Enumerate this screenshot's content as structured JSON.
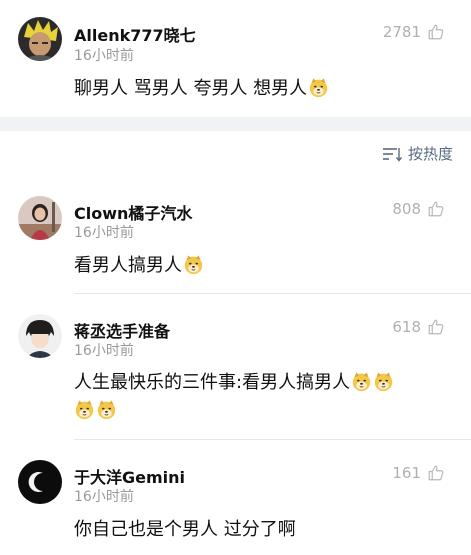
{
  "comments": [
    {
      "username": "Allenk777晓七",
      "time": "16小时前",
      "likes": "2781",
      "text_parts": [
        "聊男人 骂男人 夸男人 想男人"
      ],
      "emoji_count": 1
    },
    {
      "username": "Clown橘子汽水",
      "time": "16小时前",
      "likes": "808",
      "text_parts": [
        "看男人搞男人"
      ],
      "emoji_count": 1
    },
    {
      "username": "蒋丞选手准备",
      "time": "16小时前",
      "likes": "618",
      "text_parts": [
        "人生最快乐的三件事:看男人搞男人"
      ],
      "emoji_count": 4
    },
    {
      "username": "于大洋Gemini",
      "time": "16小时前",
      "likes": "161",
      "text_parts": [
        "你自己也是个男人 过分了啊"
      ],
      "emoji_count": 0
    }
  ],
  "sort": {
    "label": "按热度",
    "icon": "sort-lines-icon"
  },
  "icons": {
    "like": "thumbs-up-icon",
    "emoji": "doge-emoji-icon"
  },
  "colors": {
    "username": "#111111",
    "timestamp": "#9a9a9a",
    "like_count": "#b0b0b0",
    "sort_label": "#5a6b82",
    "separator_band": "#f1f2f5"
  }
}
